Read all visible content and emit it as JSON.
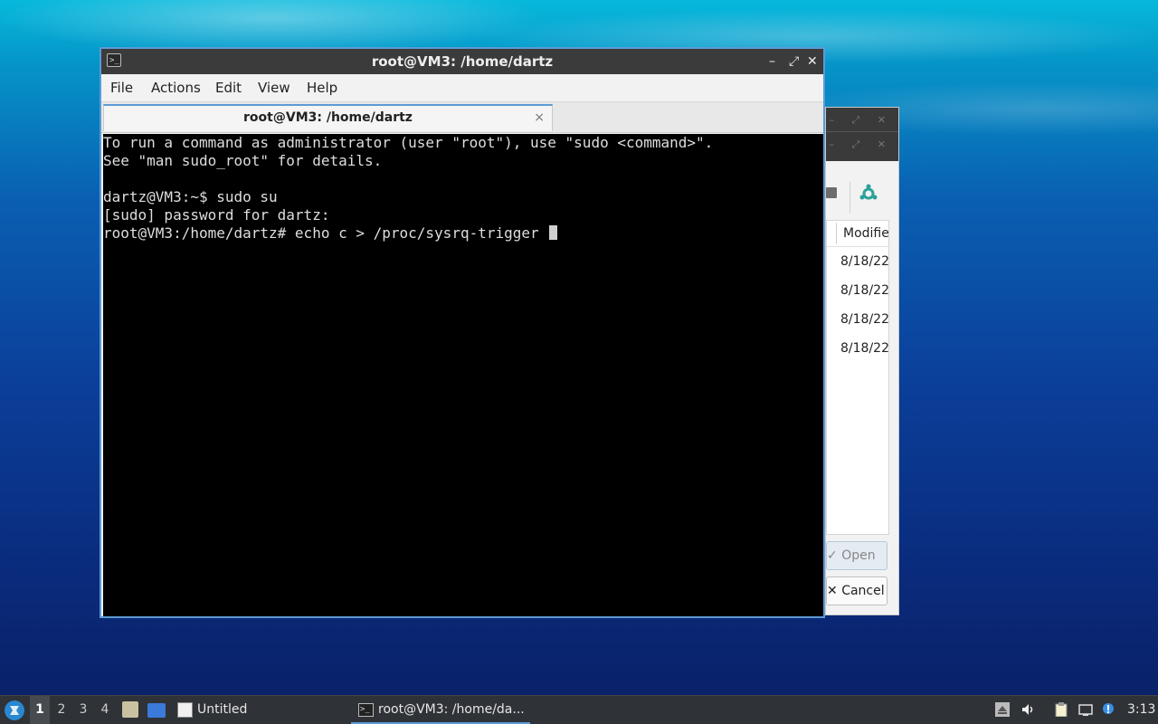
{
  "terminal": {
    "window_title": "root@VM3: /home/dartz",
    "window_icon": "terminal-icon",
    "menu": [
      "File",
      "Actions",
      "Edit",
      "View",
      "Help"
    ],
    "tab_label": "root@VM3: /home/dartz",
    "tab_close": "×",
    "controls": {
      "minimize": "–",
      "maximize": "⤢",
      "close": "✕"
    },
    "lines": [
      "To run a command as administrator (user \"root\"), use \"sudo <command>\".",
      "See \"man sudo_root\" for details.",
      "",
      "dartz@VM3:~$ sudo su",
      "[sudo] password for dartz:",
      "root@VM3:/home/dartz# echo c > /proc/sysrq-trigger "
    ]
  },
  "file_dialog": {
    "column_header": "Modifie",
    "rows": [
      "8/18/22",
      "8/18/22",
      "8/18/22",
      "8/18/22"
    ],
    "open_label": "Open",
    "cancel_label": "Cancel",
    "open_icon": "✓",
    "cancel_icon": "✕"
  },
  "taskbar": {
    "workspaces": [
      "1",
      "2",
      "3",
      "4"
    ],
    "active_workspace": "1",
    "tasks": [
      {
        "label": "Untitled",
        "icon": "text-editor-icon"
      },
      {
        "label": "root@VM3: /home/da...",
        "icon": "terminal-icon",
        "active": true
      }
    ],
    "clock": "3:13",
    "accent": "#5b9bd5"
  }
}
